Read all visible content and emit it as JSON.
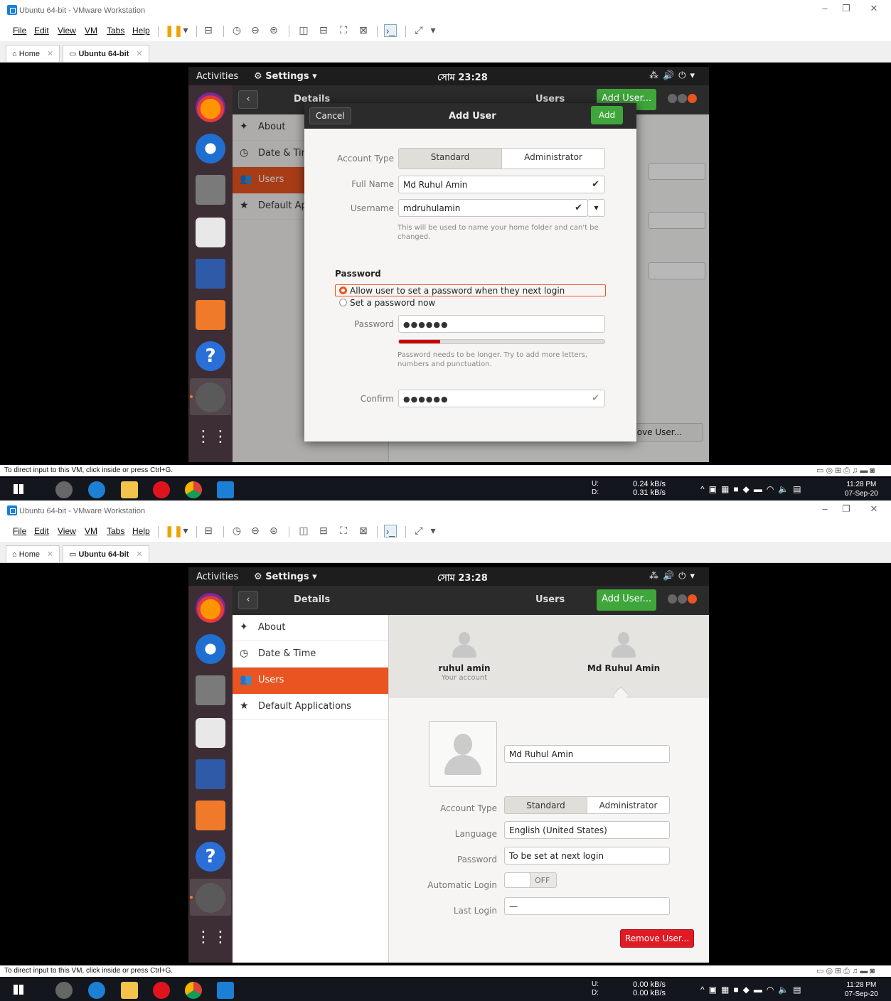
{
  "vmware": {
    "window_title": "Ubuntu 64-bit - VMware Workstation",
    "menu": [
      "File",
      "Edit",
      "View",
      "VM",
      "Tabs",
      "Help"
    ],
    "tabs": [
      "Home",
      "Ubuntu 64-bit"
    ],
    "status_hint": "To direct input to this VM, click inside or press Ctrl+G.",
    "tray_icons": [
      "hdd-icon",
      "cd-icon",
      "network-icon",
      "printer-icon",
      "sound-icon",
      "usb-icon",
      "display-icon"
    ]
  },
  "taskbar": {
    "clock_time": "11:28 PM",
    "clock_date": "07-Sep-20",
    "upload_label": "U:",
    "download_label": "D:",
    "shot1_up": "0.24 kB/s",
    "shot1_down": "0.31 kB/s",
    "shot2_up": "0.00 kB/s",
    "shot2_down": "0.00 kB/s"
  },
  "ubuntu": {
    "activities": "Activities",
    "settings_menu": "Settings ▾",
    "clock": "সোম 23:28",
    "header_details": "Details",
    "header_users": "Users",
    "add_user_button": "Add User...",
    "sidebar": [
      "About",
      "Date & Time",
      "Users",
      "Default Applications"
    ],
    "sidebar_short": [
      "About",
      "Date & Tim",
      "Users",
      "Default Ap"
    ]
  },
  "add_user_dialog": {
    "cancel": "Cancel",
    "title": "Add User",
    "add": "Add",
    "account_type_label": "Account Type",
    "standard": "Standard",
    "administrator": "Administrator",
    "full_name_label": "Full Name",
    "full_name_value": "Md Ruhul Amin",
    "username_label": "Username",
    "username_value": "mdruhulamin",
    "username_hint": "This will be used to name your home folder and can't be changed.",
    "password_section": "Password",
    "option_next_login": "Allow user to set a password when they next login",
    "option_now": "Set a password now",
    "password_label": "Password",
    "password_dots": "●●●●●●",
    "strength_fraction": 0.2,
    "password_hint": "Password needs to be longer. Try to add more letters, numbers and punctuation.",
    "confirm_label": "Confirm",
    "confirm_dots": "●●●●●●",
    "background_remove_partial": "move User..."
  },
  "users_panel": {
    "user1_name": "ruhul amin",
    "user1_sub": "Your account",
    "user2_name": "Md Ruhul Amin",
    "name_field": "Md Ruhul Amin",
    "account_type_label": "Account Type",
    "standard": "Standard",
    "administrator": "Administrator",
    "language_label": "Language",
    "language_value": "English (United States)",
    "password_label": "Password",
    "password_value": "To be set at next login",
    "autologin_label": "Automatic Login",
    "autologin_value": "OFF",
    "lastlogin_label": "Last Login",
    "lastlogin_value": "—",
    "remove_button": "Remove User..."
  }
}
